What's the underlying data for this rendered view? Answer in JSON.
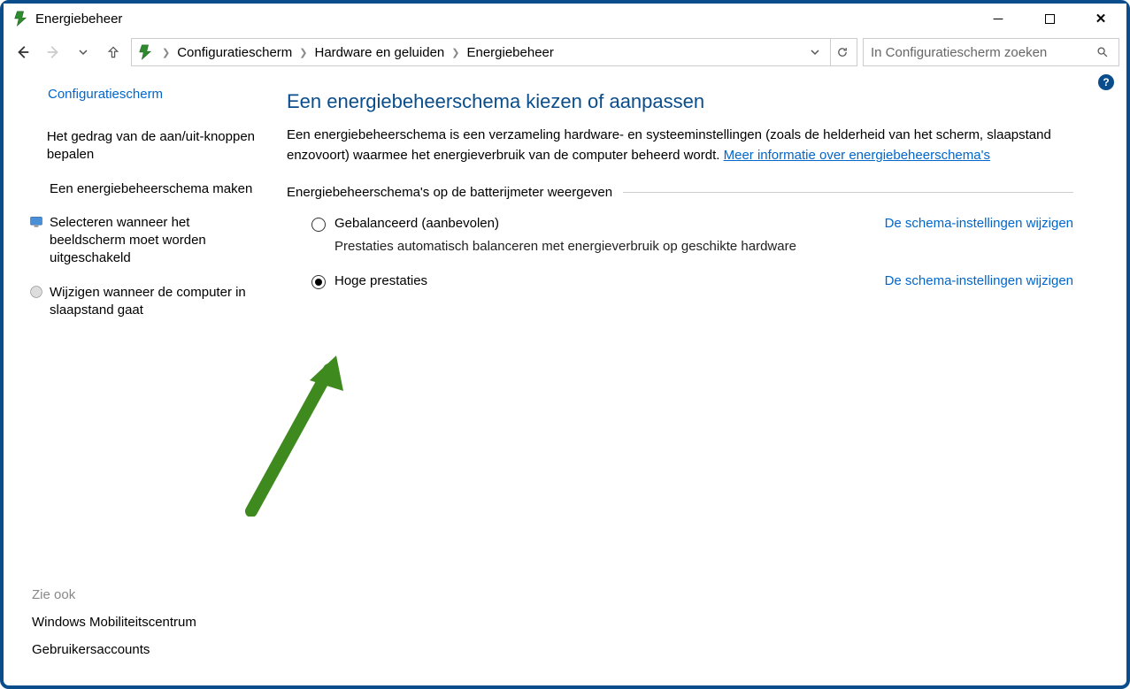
{
  "window": {
    "title": "Energiebeheer"
  },
  "nav": {
    "breadcrumb": [
      "Configuratiescherm",
      "Hardware en geluiden",
      "Energiebeheer"
    ],
    "search_placeholder": "In Configuratiescherm zoeken"
  },
  "sidebar": {
    "control_panel_home": "Configuratiescherm",
    "items": [
      {
        "label": "Het gedrag van de aan/uit-knoppen bepalen",
        "icon": null
      },
      {
        "label": "Een energiebeheerschema maken",
        "icon": null
      },
      {
        "label": "Selecteren wanneer het beeldscherm moet worden uitgeschakeld",
        "icon": "monitor"
      },
      {
        "label": "Wijzigen wanneer de computer in slaapstand gaat",
        "icon": "moon"
      }
    ],
    "see_also_heading": "Zie ook",
    "see_also": [
      "Windows Mobiliteitscentrum",
      "Gebruikersaccounts"
    ]
  },
  "main": {
    "heading": "Een energiebeheerschema kiezen of aanpassen",
    "description_pre": "Een energiebeheerschema is een verzameling hardware- en systeeminstellingen (zoals de helderheid van het scherm, slaapstand enzovoort) waarmee het energieverbruik van de computer beheerd wordt. ",
    "description_link": "Meer informatie over energiebeheerschema's",
    "group_legend": "Energiebeheerschema's op de batterijmeter weergeven",
    "settings_link_label": "De schema-instellingen wijzigen",
    "plans": [
      {
        "name": "Gebalanceerd (aanbevolen)",
        "selected": false,
        "desc": "Prestaties automatisch balanceren met energieverbruik op geschikte hardware"
      },
      {
        "name": "Hoge prestaties",
        "selected": true,
        "desc": ""
      }
    ]
  },
  "annotation": {
    "type": "arrow",
    "color": "#3f8a1f"
  }
}
